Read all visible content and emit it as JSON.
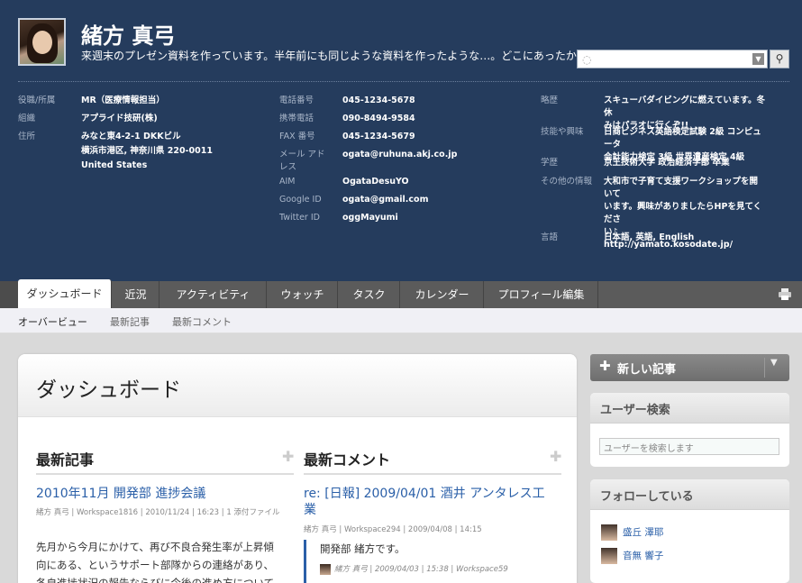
{
  "profile": {
    "name": "緒方 真弓",
    "status": "来週末のプレゼン資料を作っています。半年前にも同じような資料を作ったような…。どこにあったかな？"
  },
  "search": {
    "placeholder": ""
  },
  "info_col1": [
    {
      "label": "役職/所属",
      "value": "MR（医療情報担当）"
    },
    {
      "label": "組織",
      "value": "アプライド技研(株)"
    },
    {
      "label": "住所",
      "value": "みなと東4-2-1 DKKビル"
    },
    {
      "label": "",
      "value": "横浜市港区, 神奈川県 220-0011"
    },
    {
      "label": "",
      "value": "United States"
    }
  ],
  "info_col2": [
    {
      "label": "電話番号",
      "value": "045-1234-5678"
    },
    {
      "label": "携帯電話",
      "value": "090-8494-9584"
    },
    {
      "label": "FAX 番号",
      "value": "045-1234-5679"
    },
    {
      "label": "メール アド",
      "value": "ogata@ruhuna.akj.co.jp"
    },
    {
      "label": "レス",
      "value": ""
    },
    {
      "label": "AIM",
      "value": "OgataDesuYO"
    },
    {
      "label": "Google ID",
      "value": "ogata@gmail.com"
    },
    {
      "label": "Twitter ID",
      "value": "oggMayumi"
    }
  ],
  "info_col3": [
    {
      "label": "略歴",
      "lines": [
        "スキューバダイビングに燃えています。冬休",
        "みはパラオに行くぞ!!"
      ]
    },
    {
      "label": "技能や興味",
      "lines": [
        "日商ビジネス英語検定試験 2級 コンピュータ",
        "会計能力検定 3級 世界遺産検定 4級"
      ]
    },
    {
      "label": "学歴",
      "lines": [
        "京王技術大学 政治経済学部 卒業"
      ]
    },
    {
      "label": "その他の情報",
      "lines": [
        "大和市で子育て支援ワークショップを開いて",
        "います。興味がありましたらHPを見てくださ",
        "い♪",
        "http://yamato.kosodate.jp/"
      ]
    },
    {
      "label": "言語",
      "lines": [
        "日本語, 英語, English"
      ]
    }
  ],
  "tabs": [
    "ダッシュボード",
    "近況",
    "アクティビティ",
    "ウォッチ",
    "タスク",
    "カレンダー",
    "プロフィール編集"
  ],
  "subnav": [
    "オーバービュー",
    "最新記事",
    "最新コメント"
  ],
  "main": {
    "title": "ダッシュボード",
    "recent_posts_title": "最新記事",
    "recent_comments_title": "最新コメント",
    "post": {
      "title": "2010年11月 開発部 進捗会議",
      "meta": "緒方 真弓 | Workspace1816 | 2010/11/24 | 16:23 | 1 添付ファイル",
      "body": "先月から今月にかけて、再び不良合発生率が上昇傾向にある、というサポート部隊からの連絡があり、各自進捗状況の報告ならびに今後の進め方について"
    },
    "comment": {
      "title_line1": "re: [日報] 2009/04/01 酒井 アンタレス工",
      "title_line2": "業",
      "meta": "緒方 真弓 | Workspace294 | 2009/04/08 | 14:15",
      "text": "開発部 緒方です。",
      "cmeta": "緒方 真弓 | 2009/04/03 | 15:38 | Workspace59"
    }
  },
  "sidebar": {
    "new_post": "新しい記事",
    "user_search_title": "ユーザー検索",
    "user_search_placeholder": "ユーザーを検索します",
    "following_title": "フォローしている",
    "following": [
      "盛丘 澤耶",
      "音無 響子"
    ]
  }
}
